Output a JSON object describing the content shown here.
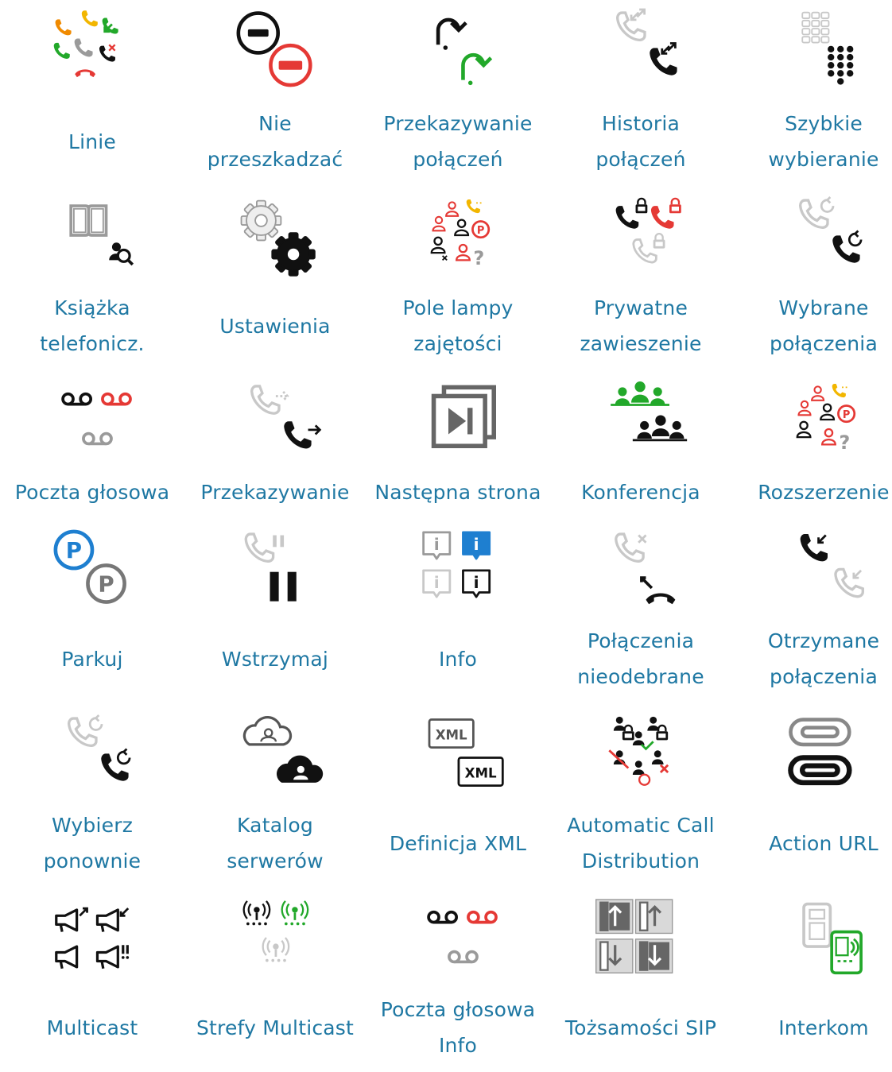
{
  "tiles": [
    {
      "lines": [
        "Linie"
      ],
      "icon": "lines-icon"
    },
    {
      "lines": [
        "Nie",
        "przeszkadzać"
      ],
      "icon": "do-not-disturb-icon"
    },
    {
      "lines": [
        "Przekazywanie",
        "połączeń"
      ],
      "icon": "call-forwarding-icon"
    },
    {
      "lines": [
        "Historia",
        "połączeń"
      ],
      "icon": "call-history-icon"
    },
    {
      "lines": [
        "Szybkie",
        "wybieranie"
      ],
      "icon": "speed-dial-icon"
    },
    {
      "lines": [
        "Książka",
        "telefonicz."
      ],
      "icon": "phonebook-icon"
    },
    {
      "lines": [
        "Ustawienia"
      ],
      "icon": "settings-icon"
    },
    {
      "lines": [
        "Pole lampy",
        "zajętości"
      ],
      "icon": "busy-lamp-field-icon"
    },
    {
      "lines": [
        "Prywatne",
        "zawieszenie"
      ],
      "icon": "private-hold-icon"
    },
    {
      "lines": [
        "Wybrane",
        "połączenia"
      ],
      "icon": "dialed-calls-icon"
    },
    {
      "lines": [
        "Poczta głosowa"
      ],
      "icon": "voicemail-icon"
    },
    {
      "lines": [
        "Przekazywanie"
      ],
      "icon": "transfer-icon"
    },
    {
      "lines": [
        "Następna strona"
      ],
      "icon": "next-page-icon"
    },
    {
      "lines": [
        "Konferencja"
      ],
      "icon": "conference-icon"
    },
    {
      "lines": [
        "Rozszerzenie"
      ],
      "icon": "extension-icon"
    },
    {
      "lines": [
        "Parkuj"
      ],
      "icon": "park-icon"
    },
    {
      "lines": [
        "Wstrzymaj"
      ],
      "icon": "hold-icon"
    },
    {
      "lines": [
        "Info"
      ],
      "icon": "info-icon"
    },
    {
      "lines": [
        "Połączenia",
        "nieodebrane"
      ],
      "icon": "missed-calls-icon"
    },
    {
      "lines": [
        "Otrzymane",
        "połączenia"
      ],
      "icon": "received-calls-icon"
    },
    {
      "lines": [
        "Wybierz",
        "ponownie"
      ],
      "icon": "redial-icon"
    },
    {
      "lines": [
        "Katalog",
        "serwerów"
      ],
      "icon": "server-directory-icon"
    },
    {
      "lines": [
        "Definicja XML"
      ],
      "icon": "xml-definition-icon"
    },
    {
      "lines": [
        "Automatic Call",
        "Distribution"
      ],
      "icon": "acd-icon"
    },
    {
      "lines": [
        "Action URL"
      ],
      "icon": "action-url-icon"
    },
    {
      "lines": [
        "Multicast"
      ],
      "icon": "multicast-icon"
    },
    {
      "lines": [
        "Strefy Multicast"
      ],
      "icon": "multicast-zones-icon"
    },
    {
      "lines": [
        "Poczta głosowa",
        "Info"
      ],
      "icon": "voicemail-info-icon"
    },
    {
      "lines": [
        "Tożsamości SIP"
      ],
      "icon": "sip-identities-icon"
    },
    {
      "lines": [
        "Interkom"
      ],
      "icon": "intercom-icon"
    }
  ],
  "xml_badge": "XML"
}
